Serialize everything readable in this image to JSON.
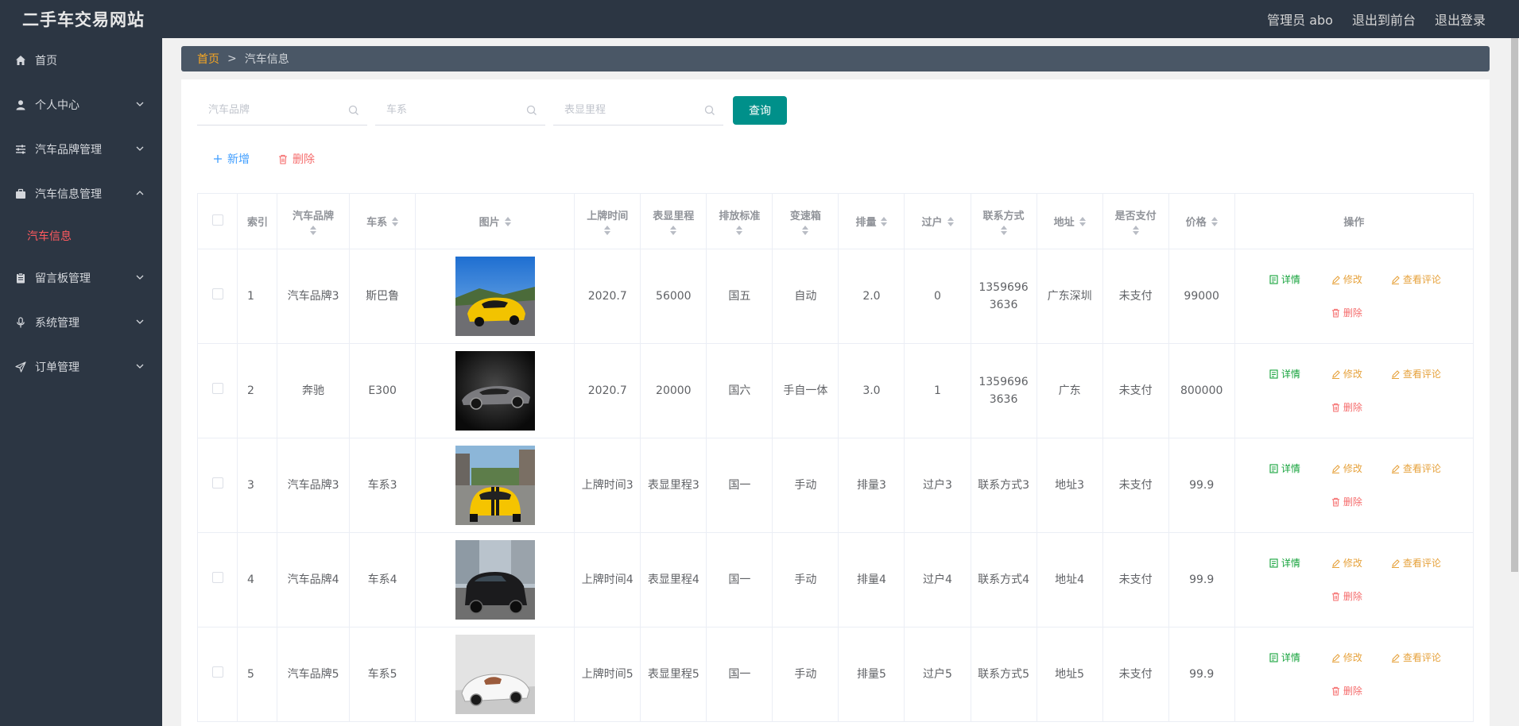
{
  "header": {
    "site_title": "二手车交易网站",
    "admin_label": "管理员 abo",
    "to_front": "退出到前台",
    "logout": "退出登录"
  },
  "sidebar": {
    "items": [
      {
        "label": "首页",
        "icon": "home-icon"
      },
      {
        "label": "个人中心",
        "icon": "user-icon"
      },
      {
        "label": "汽车品牌管理",
        "icon": "sliders-icon"
      },
      {
        "label": "汽车信息管理",
        "icon": "briefcase-icon"
      },
      {
        "label": "留言板管理",
        "icon": "clipboard-icon"
      },
      {
        "label": "系统管理",
        "icon": "microphone-icon"
      },
      {
        "label": "订单管理",
        "icon": "send-icon"
      }
    ],
    "active_sub": "汽车信息"
  },
  "breadcrumb": {
    "home": "首页",
    "separator": ">",
    "current": "汽车信息"
  },
  "search": {
    "brand_placeholder": "汽车品牌",
    "series_placeholder": "车系",
    "mileage_placeholder": "表显里程",
    "query_label": "查询"
  },
  "actions": {
    "add_label": "新增",
    "delete_label": "删除"
  },
  "table": {
    "headers": {
      "index": "索引",
      "brand": "汽车品牌",
      "series": "车系",
      "image": "图片",
      "reg_date": "上牌时间",
      "mileage": "表显里程",
      "emission": "排放标准",
      "gearbox": "变速箱",
      "displacement": "排量",
      "transfers": "过户",
      "contact": "联系方式",
      "address": "地址",
      "paid": "是否支付",
      "price": "价格",
      "ops": "操作"
    },
    "op_labels": {
      "detail": "详情",
      "edit": "修改",
      "review": "查看评论",
      "delete": "删除"
    },
    "rows": [
      {
        "index": "1",
        "brand": "汽车品牌3",
        "series": "斯巴鲁",
        "image": "yellow-sports-car",
        "reg_date": "2020.7",
        "mileage": "56000",
        "emission": "国五",
        "gearbox": "自动",
        "displacement": "2.0",
        "transfers": "0",
        "contact": "13596963636",
        "address": "广东深圳",
        "paid": "未支付",
        "price": "99000"
      },
      {
        "index": "2",
        "brand": "奔驰",
        "series": "E300",
        "image": "black-roadster",
        "reg_date": "2020.7",
        "mileage": "20000",
        "emission": "国六",
        "gearbox": "手自一体",
        "displacement": "3.0",
        "transfers": "1",
        "contact": "13596963636",
        "address": "广东",
        "paid": "未支付",
        "price": "800000"
      },
      {
        "index": "3",
        "brand": "汽车品牌3",
        "series": "车系3",
        "image": "yellow-muscle-car",
        "reg_date": "上牌时间3",
        "mileage": "表显里程3",
        "emission": "国一",
        "gearbox": "手动",
        "displacement": "排量3",
        "transfers": "过户3",
        "contact": "联系方式3",
        "address": "地址3",
        "paid": "未支付",
        "price": "99.9"
      },
      {
        "index": "4",
        "brand": "汽车品牌4",
        "series": "车系4",
        "image": "black-suv",
        "reg_date": "上牌时间4",
        "mileage": "表显里程4",
        "emission": "国一",
        "gearbox": "手动",
        "displacement": "排量4",
        "transfers": "过户4",
        "contact": "联系方式4",
        "address": "地址4",
        "paid": "未支付",
        "price": "99.9"
      },
      {
        "index": "5",
        "brand": "汽车品牌5",
        "series": "车系5",
        "image": "white-roadster",
        "reg_date": "上牌时间5",
        "mileage": "表显里程5",
        "emission": "国一",
        "gearbox": "手动",
        "displacement": "排量5",
        "transfers": "过户5",
        "contact": "联系方式5",
        "address": "地址5",
        "paid": "未支付",
        "price": "99.9"
      }
    ]
  },
  "colors": {
    "header_bg": "#2c3643",
    "breadcrumb_bg": "#4a5766",
    "accent_teal": "#00908a",
    "active_menu": "#ff5a5f",
    "detail_green": "#13a23a",
    "edit_orange": "#e6a23c",
    "delete_red": "#f56c6c",
    "add_blue": "#409eff"
  }
}
